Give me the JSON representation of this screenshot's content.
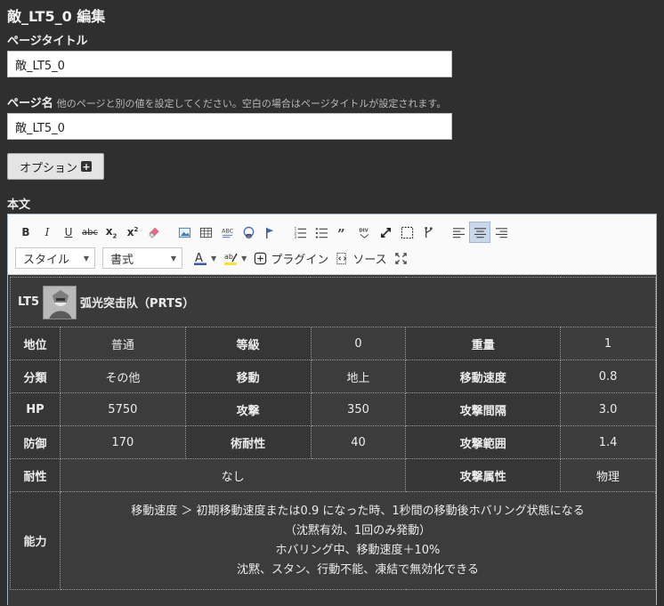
{
  "page": {
    "heading": "敵_LT5_0 編集"
  },
  "form": {
    "page_title_label": "ページタイトル",
    "page_title_value": "敵_LT5_0",
    "page_name_label": "ページ名",
    "page_name_hint": "他のページと別の値を設定してください。空白の場合はページタイトルが設定されます。",
    "page_name_value": "敵_LT5_0",
    "option_button": "オプション",
    "body_label": "本文"
  },
  "toolbar": {
    "bold": "B",
    "italic": "I",
    "underline": "U",
    "strike": "abc",
    "style_combo": "スタイル",
    "format_combo": "書式",
    "plugin_button": "プラグイン",
    "source_button": "ソース"
  },
  "enemy": {
    "code": "LT5",
    "name": "弧光突击队（PRTS）",
    "rows": [
      [
        {
          "h": "地位"
        },
        {
          "v": "普通"
        },
        {
          "h": "等級"
        },
        {
          "v": "0"
        },
        {
          "h": "重量"
        },
        {
          "v": "1"
        }
      ],
      [
        {
          "h": "分類"
        },
        {
          "v": "その他"
        },
        {
          "h": "移動"
        },
        {
          "v": "地上"
        },
        {
          "h": "移動速度"
        },
        {
          "v": "0.8"
        }
      ],
      [
        {
          "h": "HP"
        },
        {
          "v": "5750"
        },
        {
          "h": "攻撃"
        },
        {
          "v": "350"
        },
        {
          "h": "攻撃間隔"
        },
        {
          "v": "3.0"
        }
      ],
      [
        {
          "h": "防御"
        },
        {
          "v": "170"
        },
        {
          "h": "術耐性"
        },
        {
          "v": "40"
        },
        {
          "h": "攻撃範囲"
        },
        {
          "v": "1.4"
        }
      ]
    ],
    "resist_label": "耐性",
    "resist_value": "なし",
    "attack_attr_label": "攻撃属性",
    "attack_attr_value": "物理",
    "ability_label": "能力",
    "ability_lines": [
      "移動速度 ＞ 初期移動速度または0.9 になった時、1秒間の移動後ホバリング状態になる",
      "（沈黙有効、1回のみ発動）",
      "ホバリング中、移動速度＋10%",
      "沈黙、スタン、行動不能、凍結で無効化できる"
    ]
  }
}
